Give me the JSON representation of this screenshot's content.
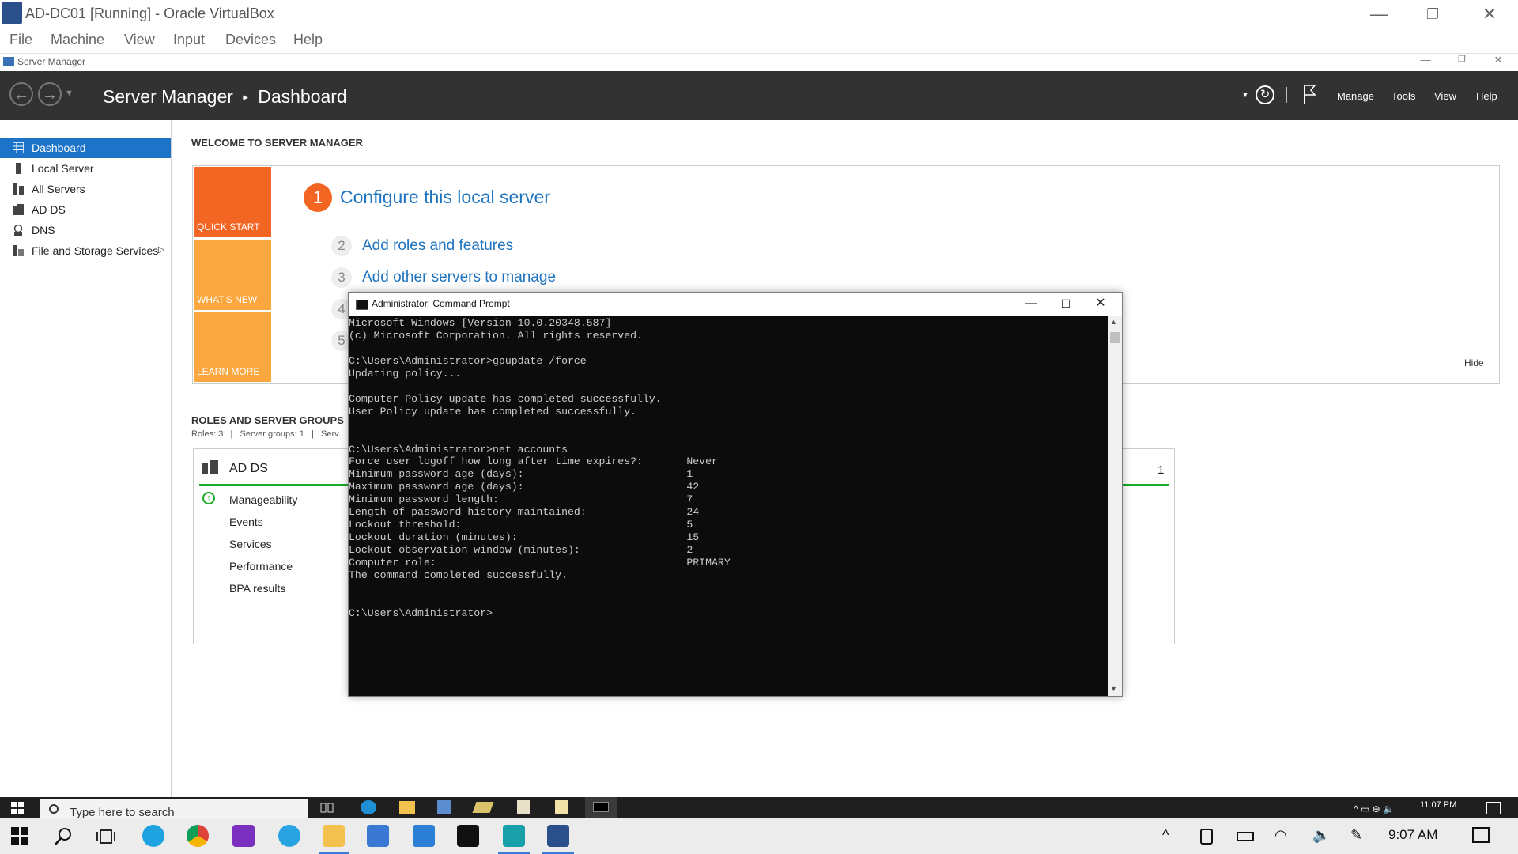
{
  "host": {
    "title": "AD-DC01 [Running] - Oracle VirtualBox",
    "menu": [
      "File",
      "Machine",
      "View",
      "Input",
      "Devices",
      "Help"
    ],
    "controls": {
      "minimize": "—",
      "restore": "❐",
      "close": "✕"
    }
  },
  "server_manager": {
    "title": "Server Manager",
    "breadcrumb": {
      "app": "Server Manager",
      "separator": "▸",
      "page": "Dashboard"
    },
    "header_menu": [
      "Manage",
      "Tools",
      "View",
      "Help"
    ],
    "sidebar": [
      {
        "label": "Dashboard",
        "icon": "dashboard-icon",
        "active": true
      },
      {
        "label": "Local Server",
        "icon": "server-icon"
      },
      {
        "label": "All Servers",
        "icon": "servers-icon"
      },
      {
        "label": "AD DS",
        "icon": "adds-icon"
      },
      {
        "label": "DNS",
        "icon": "dns-icon"
      },
      {
        "label": "File and Storage Services",
        "icon": "storage-icon",
        "chevron": "▷"
      }
    ],
    "welcome": {
      "title": "WELCOME TO SERVER MANAGER",
      "tiles": [
        "QUICK START",
        "WHAT'S NEW",
        "LEARN MORE"
      ],
      "steps": [
        {
          "num": "1",
          "label": "Configure this local server"
        },
        {
          "num": "2",
          "label": "Add roles and features"
        },
        {
          "num": "3",
          "label": "Add other servers to manage"
        },
        {
          "num": "4",
          "label": ""
        },
        {
          "num": "5",
          "label": ""
        }
      ],
      "hide": "Hide"
    },
    "roles": {
      "title": "ROLES AND SERVER GROUPS",
      "subtitle": "Roles: 3   |   Server groups: 1   |   Serv",
      "card_title": "AD DS",
      "card_count": "1",
      "items": [
        "Manageability",
        "Events",
        "Services",
        "Performance",
        "BPA results"
      ]
    }
  },
  "cmd": {
    "title": "Administrator: Command Prompt",
    "lines": [
      "Microsoft Windows [Version 10.0.20348.587]",
      "(c) Microsoft Corporation. All rights reserved.",
      "",
      "C:\\Users\\Administrator>gpupdate /force",
      "Updating policy...",
      "",
      "Computer Policy update has completed successfully.",
      "User Policy update has completed successfully.",
      "",
      "",
      "C:\\Users\\Administrator>net accounts",
      "Force user logoff how long after time expires?:       Never",
      "Minimum password age (days):                          1",
      "Maximum password age (days):                          42",
      "Minimum password length:                              7",
      "Length of password history maintained:                24",
      "Lockout threshold:                                    5",
      "Lockout duration (minutes):                           15",
      "Lockout observation window (minutes):                 2",
      "Computer role:                                        PRIMARY",
      "The command completed successfully.",
      "",
      "",
      "C:\\Users\\Administrator>"
    ]
  },
  "guest_taskbar": {
    "search_placeholder": "Type here to search",
    "time": "11:07 PM"
  },
  "host_taskbar": {
    "time": "9:07 AM"
  },
  "colors": {
    "accent_blue": "#1c73c8",
    "quick_start_orange": "#f26522",
    "tile_yellow": "#f9a73e",
    "header_dark": "#323232",
    "status_green": "#1aaa28"
  }
}
